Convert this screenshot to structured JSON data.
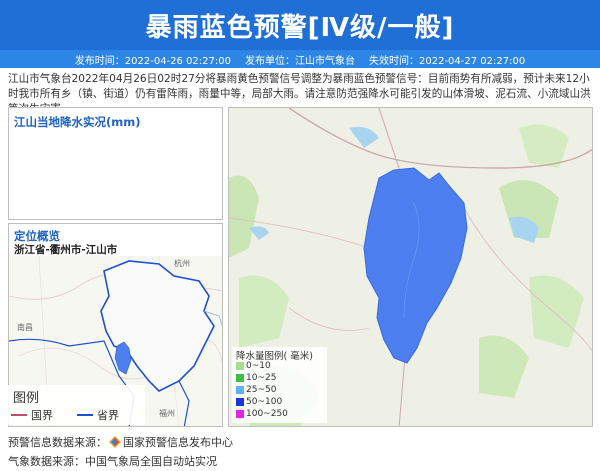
{
  "header": {
    "title": "暴雨蓝色预警[Ⅳ级/一般]"
  },
  "infobar": {
    "publish_time": "发布时间：2022-04-26 02:27:00",
    "publisher": "发布单位：江山市气象台",
    "expire_time": "失效时间：2022-04-27 02:27:00"
  },
  "description": "江山市气象台2022年04月26日02时27分将暴雨黄色预警信号调整为暴雨蓝色预警信号：目前雨势有所减弱，预计未来12小时我市所有乡（镇、街道）仍有雷阵雨，雨量中等，局部大雨。请注意防范强降水可能引发的山体滑坡、泥石流、小流域山洪等次生灾害。",
  "panel_rain": {
    "title": "江山当地降水实况(mm)"
  },
  "panel_location": {
    "title": "定位概览",
    "subtitle": "浙江省-衢州市-江山市",
    "map_labels": [
      "杭州",
      "南昌",
      "福州"
    ]
  },
  "small_legend": {
    "title": "图例",
    "national": "国界",
    "provincial": "省界",
    "national_color": "#c0506a",
    "provincial_color": "#1f4fd6"
  },
  "rain_legend": {
    "title": "降水量图例( 毫米)",
    "items": [
      {
        "label": "0~10",
        "color": "#a9dd8f"
      },
      {
        "label": "10~25",
        "color": "#3fbd46"
      },
      {
        "label": "25~50",
        "color": "#60b3f2"
      },
      {
        "label": "50~100",
        "color": "#1a35d8"
      },
      {
        "label": "100~250",
        "color": "#e227e2"
      }
    ]
  },
  "region_color": "#4d7ff0",
  "footer": {
    "warning_source": "预警信息数据来源：",
    "warning_source_name": "国家预警信息发布中心",
    "weather_source": "气象数据来源：中国气象局全国自动站实况"
  }
}
